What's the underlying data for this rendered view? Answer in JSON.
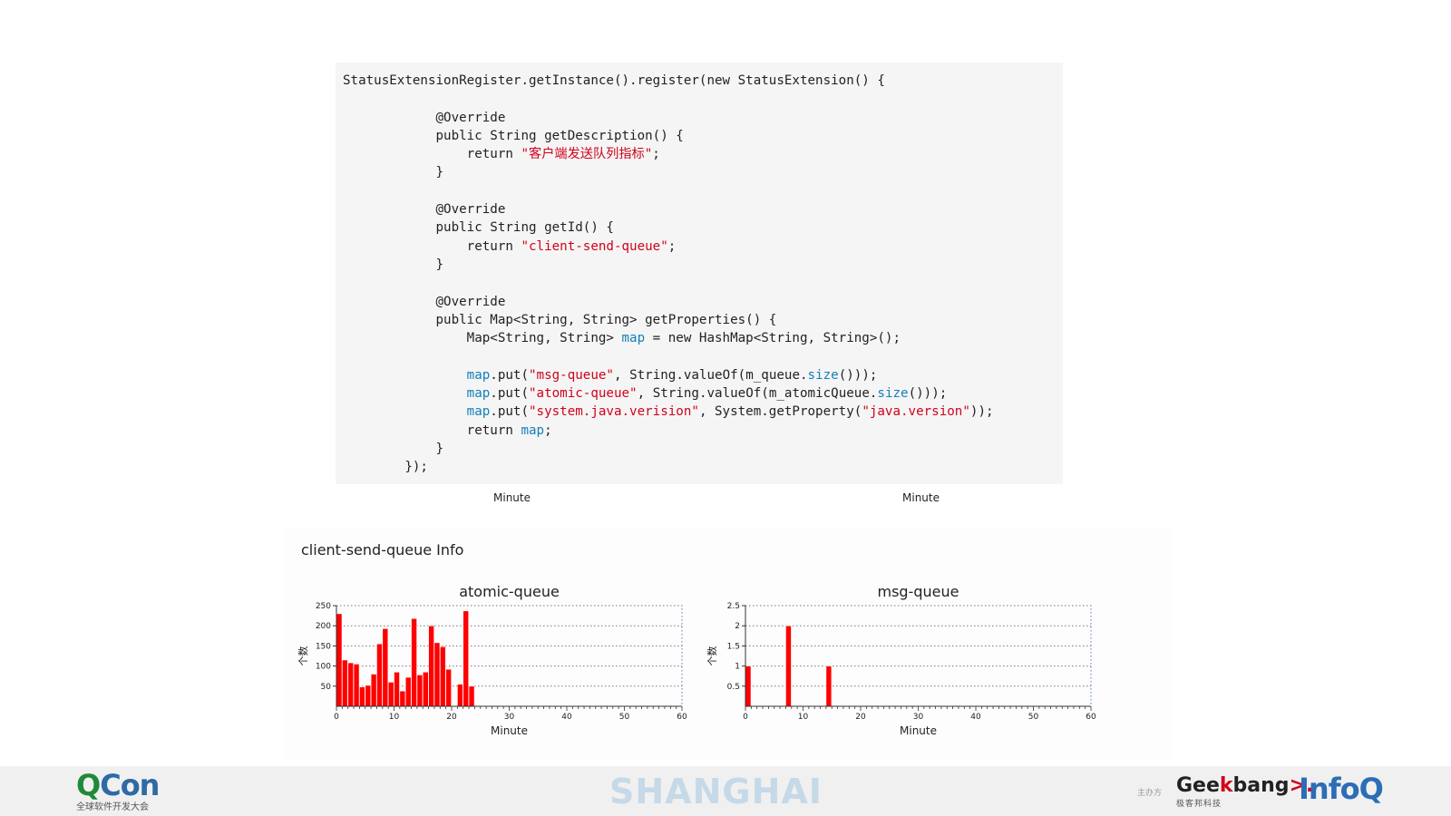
{
  "code": {
    "lines": [
      [
        {
          "t": "StatusExtensionRegister.getInstance().register(new StatusExtension() {"
        }
      ],
      [
        {
          "t": ""
        }
      ],
      [
        {
          "t": "            @Override"
        }
      ],
      [
        {
          "t": "            public String getDescription() {"
        }
      ],
      [
        {
          "t": "                return "
        },
        {
          "t": "\"客户端发送队列指标\"",
          "c": "s"
        },
        {
          "t": ";"
        }
      ],
      [
        {
          "t": "            }"
        }
      ],
      [
        {
          "t": ""
        }
      ],
      [
        {
          "t": "            @Override"
        }
      ],
      [
        {
          "t": "            public String getId() {"
        }
      ],
      [
        {
          "t": "                return "
        },
        {
          "t": "\"client-send-queue\"",
          "c": "s"
        },
        {
          "t": ";"
        }
      ],
      [
        {
          "t": "            }"
        }
      ],
      [
        {
          "t": ""
        }
      ],
      [
        {
          "t": "            @Override"
        }
      ],
      [
        {
          "t": "            public Map<String, String> getProperties() {"
        }
      ],
      [
        {
          "t": "                Map<String, String> "
        },
        {
          "t": "map",
          "c": "v"
        },
        {
          "t": " = new HashMap<String, String>();"
        }
      ],
      [
        {
          "t": ""
        }
      ],
      [
        {
          "t": "map",
          "c": "v",
          "pre": "                "
        },
        {
          "t": ".put("
        },
        {
          "t": "\"msg-queue\"",
          "c": "s"
        },
        {
          "t": ", String.valueOf(m_queue."
        },
        {
          "t": "size",
          "c": "v"
        },
        {
          "t": "()));"
        }
      ],
      [
        {
          "t": "map",
          "c": "v",
          "pre": "                "
        },
        {
          "t": ".put("
        },
        {
          "t": "\"atomic-queue\"",
          "c": "s"
        },
        {
          "t": ", String.valueOf(m_atomicQueue."
        },
        {
          "t": "size",
          "c": "v"
        },
        {
          "t": "()));"
        }
      ],
      [
        {
          "t": "map",
          "c": "v",
          "pre": "                "
        },
        {
          "t": ".put("
        },
        {
          "t": "\"system.java.verision\"",
          "c": "s"
        },
        {
          "t": ", System.getProperty("
        },
        {
          "t": "\"java.version\"",
          "c": "s"
        },
        {
          "t": "));"
        }
      ],
      [
        {
          "t": "                return "
        },
        {
          "t": "map",
          "c": "v"
        },
        {
          "t": ";"
        }
      ],
      [
        {
          "t": "            }"
        }
      ],
      [
        {
          "t": "        });"
        }
      ]
    ]
  },
  "top_minute_labels": [
    "Minute",
    "Minute"
  ],
  "section": {
    "title": "client-send-queue Info"
  },
  "chart_data": [
    {
      "type": "bar",
      "title": "atomic-queue",
      "xlabel": "Minute",
      "ylabel": "个数",
      "x": [
        0,
        1,
        2,
        3,
        4,
        5,
        6,
        7,
        8,
        9,
        10,
        11,
        12,
        13,
        14,
        15,
        16,
        17,
        18,
        19,
        20,
        21,
        22,
        23
      ],
      "values": [
        230,
        115,
        108,
        105,
        48,
        52,
        80,
        155,
        193,
        60,
        85,
        38,
        72,
        218,
        78,
        85,
        200,
        158,
        148,
        92,
        0,
        55,
        237,
        50
      ],
      "xlim": [
        0,
        60
      ],
      "xticks": [
        0,
        10,
        20,
        30,
        40,
        50,
        60
      ],
      "ylim": [
        0,
        250
      ],
      "yticks": [
        50,
        100,
        150,
        200,
        250
      ],
      "grid": true,
      "bar_color": "#ff0000"
    },
    {
      "type": "bar",
      "title": "msg-queue",
      "xlabel": "Minute",
      "ylabel": "个数",
      "x": [
        0,
        7,
        14
      ],
      "values": [
        1,
        2,
        1
      ],
      "xlim": [
        0,
        60
      ],
      "xticks": [
        0,
        10,
        20,
        30,
        40,
        50,
        60
      ],
      "ylim": [
        0,
        2.5
      ],
      "yticks": [
        0.5,
        1,
        1.5,
        2,
        2.5
      ],
      "grid": true,
      "bar_color": "#ff0000"
    }
  ],
  "footer": {
    "qcon_q": "Q",
    "qcon_rest": "Con",
    "qcon_sub": "全球软件开发大会",
    "city": "SHANGHAI",
    "organizer": "主办方",
    "geek_a": "Gee",
    "geek_k": "k",
    "geek_b": "bang",
    "geek_arrow": ">.",
    "geek_sub": "极客邦科技",
    "infoq": "InfoQ"
  }
}
